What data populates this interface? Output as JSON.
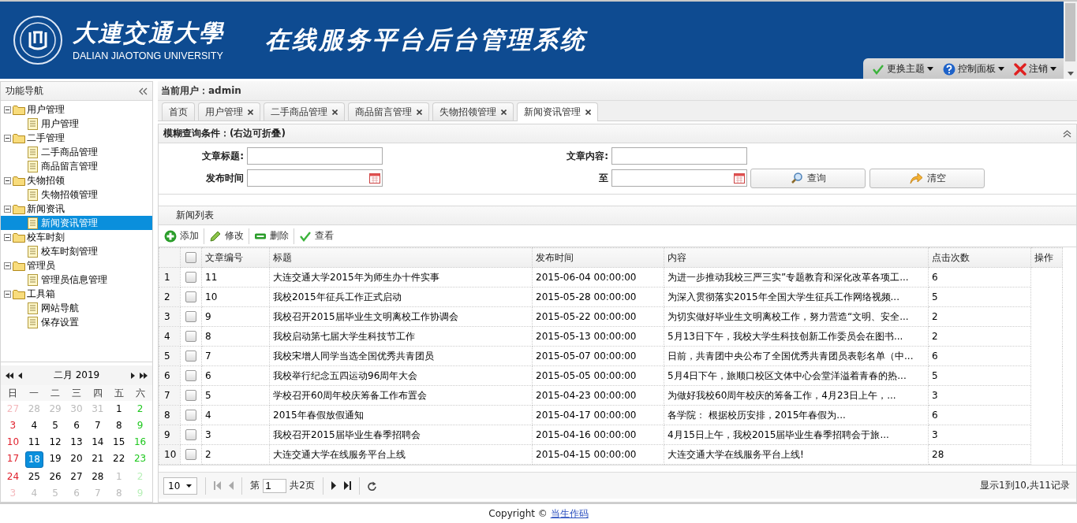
{
  "header": {
    "logo_name": "大連交通大學",
    "logo_english": "DALIAN JIAOTONG UNIVERSITY",
    "system_title": "在线服务平台后台管理系统",
    "menus": [
      {
        "label": "更换主题",
        "kind": "theme"
      },
      {
        "label": "控制面板",
        "kind": "help"
      },
      {
        "label": "注销",
        "kind": "logout"
      }
    ]
  },
  "sidebar": {
    "title": "功能导航",
    "tree": [
      {
        "label": "用户管理",
        "expanded": true,
        "children": [
          {
            "label": "用户管理",
            "selected": false
          }
        ]
      },
      {
        "label": "二手管理",
        "expanded": true,
        "children": [
          {
            "label": "二手商品管理",
            "selected": false
          },
          {
            "label": "商品留言管理",
            "selected": false
          }
        ]
      },
      {
        "label": "失物招领",
        "expanded": true,
        "children": [
          {
            "label": "失物招领管理",
            "selected": false
          }
        ]
      },
      {
        "label": "新闻资讯",
        "expanded": true,
        "children": [
          {
            "label": "新闻资讯管理",
            "selected": true
          }
        ]
      },
      {
        "label": "校车时刻",
        "expanded": true,
        "children": [
          {
            "label": "校车时刻管理",
            "selected": false
          }
        ]
      },
      {
        "label": "管理员",
        "expanded": true,
        "children": [
          {
            "label": "管理员信息管理",
            "selected": false
          }
        ]
      },
      {
        "label": "工具箱",
        "expanded": true,
        "children": [
          {
            "label": "网站导航",
            "selected": false
          },
          {
            "label": "保存设置",
            "selected": false
          }
        ]
      }
    ]
  },
  "calendar": {
    "title": "二月 2019",
    "weekdays": [
      "日",
      "一",
      "二",
      "三",
      "四",
      "五",
      "六"
    ],
    "days": [
      {
        "text": "27",
        "outside": true,
        "selected": false
      },
      {
        "text": "28",
        "outside": true,
        "selected": false
      },
      {
        "text": "29",
        "outside": true,
        "selected": false
      },
      {
        "text": "30",
        "outside": true,
        "selected": false
      },
      {
        "text": "31",
        "outside": true,
        "selected": false
      },
      {
        "text": "1",
        "outside": false,
        "selected": false
      },
      {
        "text": "2",
        "outside": false,
        "selected": false
      },
      {
        "text": "3",
        "outside": false,
        "selected": false
      },
      {
        "text": "4",
        "outside": false,
        "selected": false
      },
      {
        "text": "5",
        "outside": false,
        "selected": false
      },
      {
        "text": "6",
        "outside": false,
        "selected": false
      },
      {
        "text": "7",
        "outside": false,
        "selected": false
      },
      {
        "text": "8",
        "outside": false,
        "selected": false
      },
      {
        "text": "9",
        "outside": false,
        "selected": false
      },
      {
        "text": "10",
        "outside": false,
        "selected": false
      },
      {
        "text": "11",
        "outside": false,
        "selected": false
      },
      {
        "text": "12",
        "outside": false,
        "selected": false
      },
      {
        "text": "13",
        "outside": false,
        "selected": false
      },
      {
        "text": "14",
        "outside": false,
        "selected": false
      },
      {
        "text": "15",
        "outside": false,
        "selected": false
      },
      {
        "text": "16",
        "outside": false,
        "selected": false
      },
      {
        "text": "17",
        "outside": false,
        "selected": false
      },
      {
        "text": "18",
        "outside": false,
        "selected": true
      },
      {
        "text": "19",
        "outside": false,
        "selected": false
      },
      {
        "text": "20",
        "outside": false,
        "selected": false
      },
      {
        "text": "21",
        "outside": false,
        "selected": false
      },
      {
        "text": "22",
        "outside": false,
        "selected": false
      },
      {
        "text": "23",
        "outside": false,
        "selected": false
      },
      {
        "text": "24",
        "outside": false,
        "selected": false
      },
      {
        "text": "25",
        "outside": false,
        "selected": false
      },
      {
        "text": "26",
        "outside": false,
        "selected": false
      },
      {
        "text": "27",
        "outside": false,
        "selected": false
      },
      {
        "text": "28",
        "outside": false,
        "selected": false
      },
      {
        "text": "1",
        "outside": true,
        "selected": false
      },
      {
        "text": "2",
        "outside": true,
        "selected": false
      },
      {
        "text": "3",
        "outside": true,
        "selected": false
      },
      {
        "text": "4",
        "outside": true,
        "selected": false
      },
      {
        "text": "5",
        "outside": true,
        "selected": false
      },
      {
        "text": "6",
        "outside": true,
        "selected": false
      },
      {
        "text": "7",
        "outside": true,
        "selected": false
      },
      {
        "text": "8",
        "outside": true,
        "selected": false
      },
      {
        "text": "9",
        "outside": true,
        "selected": false
      }
    ]
  },
  "current_user": {
    "label": "当前用户：",
    "name": "admin"
  },
  "tabs": [
    {
      "label": "首页",
      "selected": false,
      "closable": false
    },
    {
      "label": "用户管理",
      "selected": false,
      "closable": true
    },
    {
      "label": "二手商品管理",
      "selected": false,
      "closable": true
    },
    {
      "label": "商品留言管理",
      "selected": false,
      "closable": true
    },
    {
      "label": "失物招领管理",
      "selected": false,
      "closable": true
    },
    {
      "label": "新闻资讯管理",
      "selected": true,
      "closable": true
    }
  ],
  "search": {
    "title": "模糊查询条件：(右边可折叠)",
    "fields": [
      {
        "label": "文章标题:",
        "kind": "text"
      },
      {
        "label": "文章内容:",
        "kind": "text"
      },
      {
        "label": "发布时间",
        "kind": "date"
      },
      {
        "label": "至",
        "kind": "date"
      }
    ],
    "buttons": [
      {
        "label": "查询",
        "kind": "search"
      },
      {
        "label": "清空",
        "kind": "clear"
      }
    ]
  },
  "news": {
    "title": "新闻列表",
    "toolbar": [
      {
        "label": "添加",
        "kind": "add"
      },
      {
        "label": "修改",
        "kind": "edit"
      },
      {
        "label": "删除",
        "kind": "delete"
      },
      {
        "label": "查看",
        "kind": "view"
      }
    ],
    "columns": [
      "文章编号",
      "标题",
      "发布时间",
      "内容",
      "点击次数",
      "操作"
    ],
    "header_checked": false,
    "rows": [
      {
        "index": "1",
        "checked": false,
        "cells": [
          "11",
          "大连交通大学2015年为师生办十件实事",
          "2015-06-04 00:00:00",
          "为进一步推动我校三严三实”专题教育和深化改革各项工...",
          "6",
          ""
        ]
      },
      {
        "index": "2",
        "checked": false,
        "cells": [
          "10",
          "我校2015年征兵工作正式启动",
          "2015-05-28 00:00:00",
          "为深入贯彻落实2015年全国大学生征兵工作网络视频...",
          "5",
          ""
        ]
      },
      {
        "index": "3",
        "checked": false,
        "cells": [
          "9",
          "我校召开2015届毕业生文明离校工作协调会",
          "2015-05-22 00:00:00",
          "为切实做好毕业生文明离校工作，努力营造“文明、安全...",
          "2",
          ""
        ]
      },
      {
        "index": "4",
        "checked": false,
        "cells": [
          "8",
          "我校启动第七届大学生科技节工作",
          "2015-05-13 00:00:00",
          "5月13日下午，我校大学生科技创新工作委员会在图书...",
          "2",
          ""
        ]
      },
      {
        "index": "5",
        "checked": false,
        "cells": [
          "7",
          "我校宋增人同学当选全国优秀共青团员",
          "2015-05-07 00:00:00",
          "日前，共青团中央公布了全国优秀共青团员表彰名单（中...",
          "6",
          ""
        ]
      },
      {
        "index": "6",
        "checked": false,
        "cells": [
          "6",
          "我校举行纪念五四运动96周年大会",
          "2015-05-05 00:00:00",
          "5月4日下午，旅顺口校区文体中心会堂洋溢着青春的热...",
          "5",
          ""
        ]
      },
      {
        "index": "7",
        "checked": false,
        "cells": [
          "5",
          "学校召开60周年校庆筹备工作布置会",
          "2015-04-23 00:00:00",
          "为做好我校60周年校庆的筹备工作，4月23日上午，...",
          "3",
          ""
        ]
      },
      {
        "index": "8",
        "checked": false,
        "cells": [
          "4",
          "2015年春假放假通知",
          "2015-04-17 00:00:00",
          "各学院： 根据校历安排，2015年春假为...",
          "6",
          ""
        ]
      },
      {
        "index": "9",
        "checked": false,
        "cells": [
          "3",
          "我校召开2015届毕业生春季招聘会",
          "2015-04-16 00:00:00",
          "4月15日上午，我校2015届毕业生春季招聘会于旅...",
          "3",
          ""
        ]
      },
      {
        "index": "10",
        "checked": false,
        "cells": [
          "2",
          "大连交通大学在线服务平台上线",
          "2015-04-15 00:00:00",
          "大连交通大学在线服务平台上线!",
          "28",
          ""
        ]
      }
    ]
  },
  "pager": {
    "page_size": "10",
    "page_label": "第",
    "page": "1",
    "total_label": "共2页",
    "summary": "显示1到10,共11记录"
  },
  "footer": {
    "text": "Copyright ©",
    "link": "当生作码"
  }
}
